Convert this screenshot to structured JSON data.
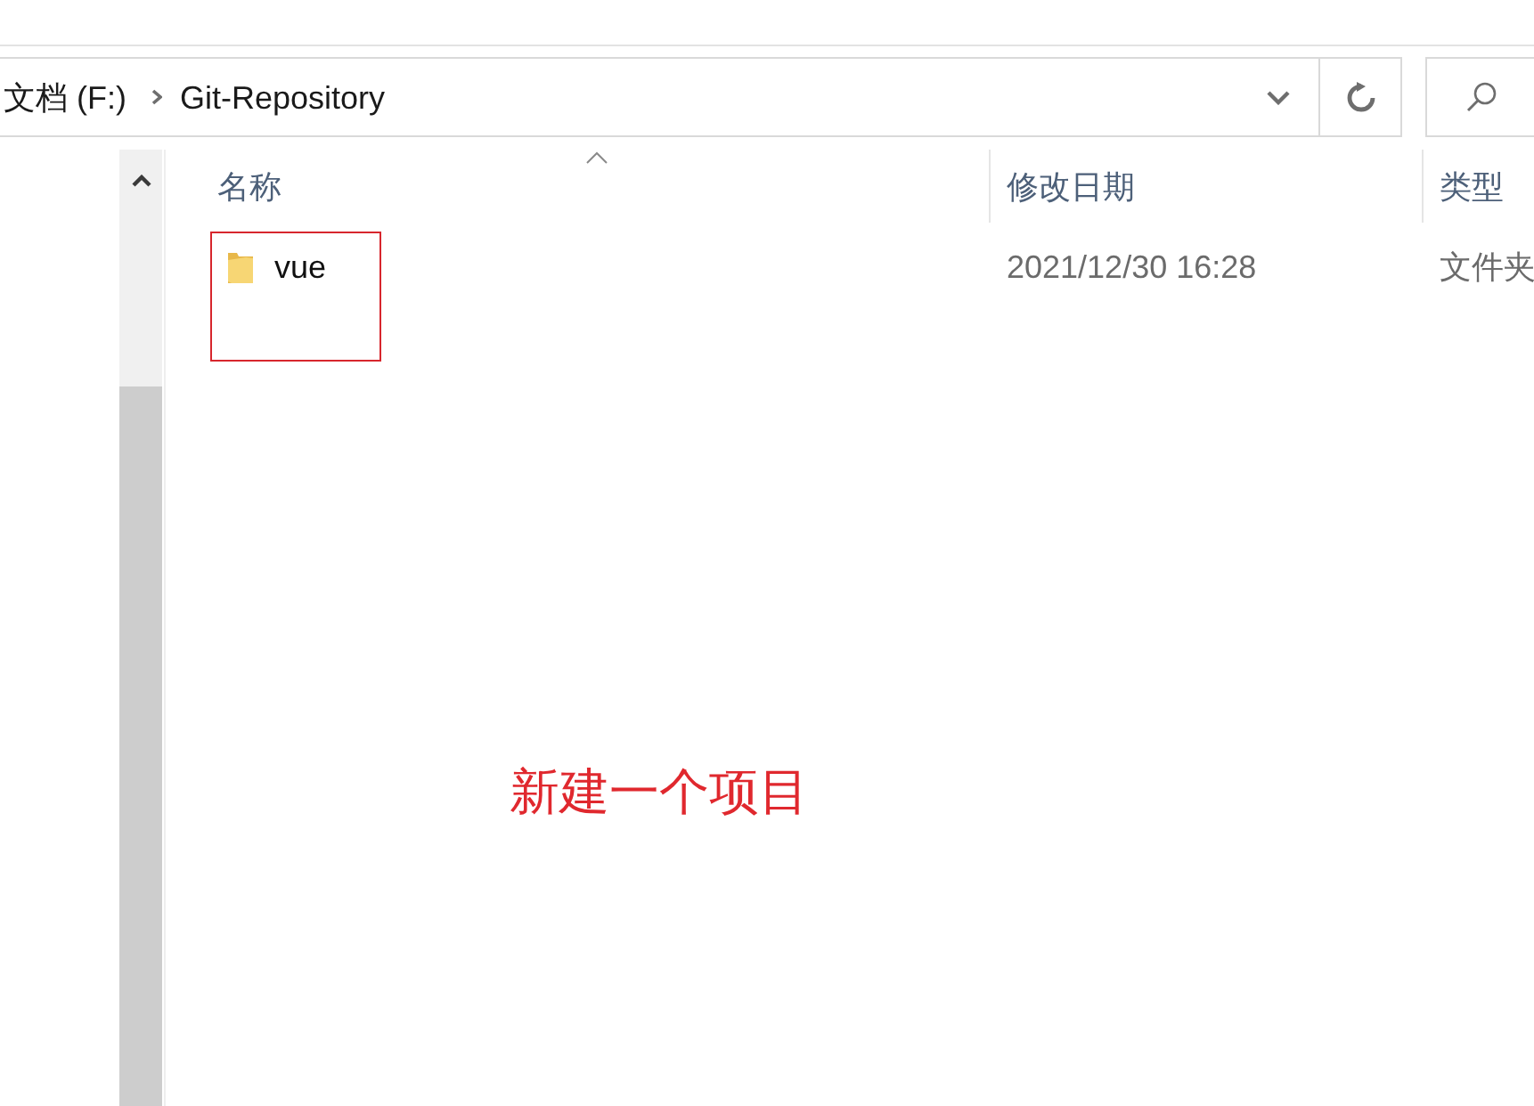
{
  "address_bar": {
    "breadcrumbs": [
      "文档 (F:)",
      "Git-Repository"
    ]
  },
  "file_list": {
    "columns": [
      {
        "label": "名称",
        "sorted": true
      },
      {
        "label": "修改日期",
        "sorted": false
      },
      {
        "label": "类型",
        "sorted": false
      }
    ],
    "rows": [
      {
        "name": "vue",
        "modified": "2021/12/30 16:28",
        "type": "文件夹",
        "annotated": true
      }
    ]
  },
  "annotation": {
    "text": "新建一个项目"
  }
}
